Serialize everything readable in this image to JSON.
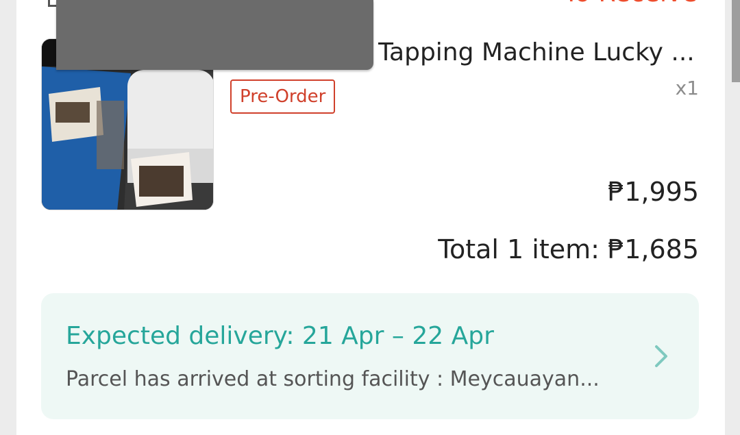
{
  "header": {
    "status": "To Receive"
  },
  "product": {
    "title": "Tapping Machine Lucky ...",
    "badge": "Pre-Order",
    "quantity": "x1",
    "price": "₱1,995",
    "total_label": "Total 1 item: ₱1,685"
  },
  "delivery": {
    "title": "Expected delivery: 21 Apr – 22 Apr",
    "status": "Parcel has arrived at sorting facility : Meycauayan..."
  },
  "colors": {
    "accent": "#ee4d2d",
    "teal": "#26a69a",
    "delivery_bg": "#eef8f5"
  },
  "icons": {
    "delivery_chevron": "chevron-right-icon"
  }
}
